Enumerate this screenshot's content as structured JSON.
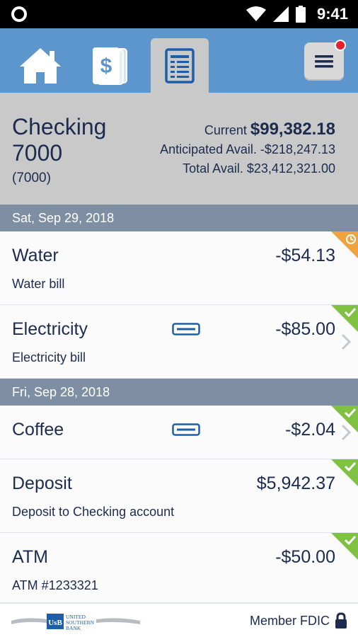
{
  "status_bar": {
    "time": "9:41"
  },
  "nav": {
    "tabs": [
      {
        "name": "home",
        "icon": "home-icon"
      },
      {
        "name": "transfers",
        "icon": "dollar-bill-icon"
      },
      {
        "name": "register",
        "icon": "register-list-icon",
        "active": true
      }
    ],
    "menu_icon": "hamburger-menu-icon",
    "menu_badge": true
  },
  "account": {
    "name": "Checking 7000",
    "number": "(7000)",
    "current_label": "Current",
    "current_value": "$99,382.18",
    "anticipated_label": "Anticipated Avail.",
    "anticipated_value": "-$218,247.13",
    "total_label": "Total Avail.",
    "total_value": "$23,412,321.00"
  },
  "date_groups": [
    {
      "date": "Sat, Sep 29, 2018",
      "transactions": [
        {
          "title": "Water",
          "description": "Water bill",
          "amount": "-$54.13",
          "status": "pending",
          "card": false,
          "chevron": false
        },
        {
          "title": "Electricity",
          "description": "Electricity bill",
          "amount": "-$85.00",
          "status": "cleared",
          "card": true,
          "chevron": true
        }
      ]
    },
    {
      "date": "Fri, Sep 28, 2018",
      "transactions": [
        {
          "title": "Coffee",
          "description": "",
          "amount": "-$2.04",
          "status": "cleared",
          "card": true,
          "chevron": true
        },
        {
          "title": "Deposit",
          "description": "Deposit to Checking account",
          "amount": "$5,942.37",
          "status": "cleared",
          "card": false,
          "chevron": false
        },
        {
          "title": "ATM",
          "description": "ATM #1233321",
          "amount": "-$50.00",
          "status": "cleared",
          "card": false,
          "chevron": false
        }
      ]
    }
  ],
  "footer": {
    "logo_text": [
      "UNITED",
      "SOUTHERN",
      "BANK"
    ],
    "logo_mark": "UsB",
    "member_text": "Member FDIC"
  },
  "colors": {
    "nav_bg": "#5d96cd",
    "active_tab": "#c9c9c9",
    "date_header": "#7e8fa3",
    "text_navy": "#1d2b4f",
    "cleared_green": "#7fc241",
    "pending_orange": "#f0a23c",
    "badge_red": "#e8202e"
  }
}
